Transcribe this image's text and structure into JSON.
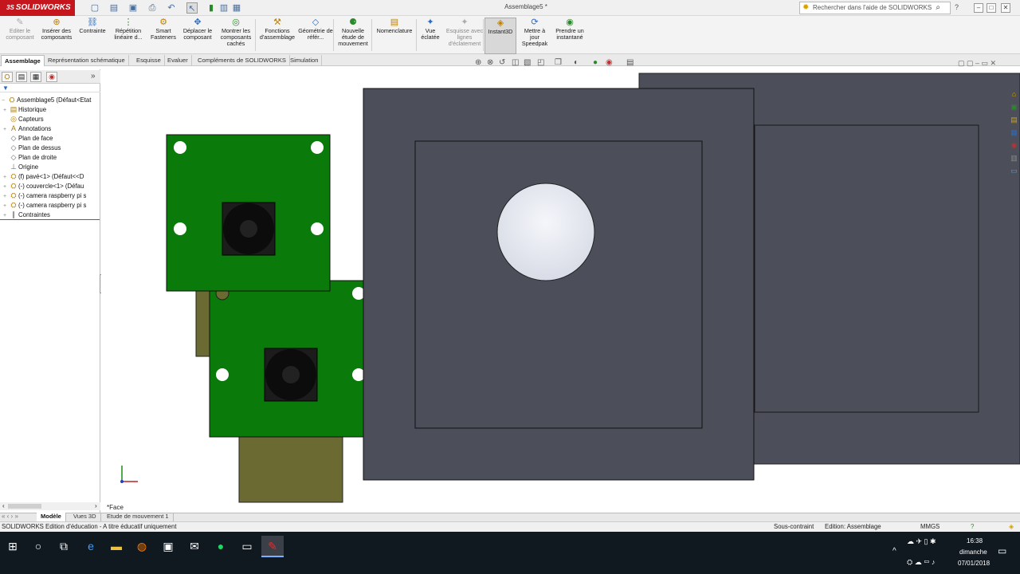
{
  "app": {
    "logo_text": "SOLIDWORKS",
    "logo_prefix": "3S",
    "document_title": "Assemblage5 *"
  },
  "search": {
    "placeholder": "Rechercher dans l'aide de SOLIDWORKS"
  },
  "ribbon": [
    {
      "label": "Editer le composant",
      "icon": "edit-component-icon",
      "disabled": true
    },
    {
      "label": "Insérer des composants",
      "icon": "insert-components-icon"
    },
    {
      "label": "Contrainte",
      "icon": "mate-icon"
    },
    {
      "label": "Répétition linéaire d...",
      "icon": "linear-pattern-icon"
    },
    {
      "label": "Smart Fasteners",
      "icon": "smart-fasteners-icon"
    },
    {
      "label": "Déplacer le composant",
      "icon": "move-component-icon"
    },
    {
      "label": "Montrer les composants cachés",
      "icon": "show-hidden-icon"
    },
    {
      "label": "Fonctions d'assemblage",
      "icon": "assembly-features-icon"
    },
    {
      "label": "Géométrie de référ...",
      "icon": "reference-geometry-icon"
    },
    {
      "label": "Nouvelle étude de mouvement",
      "icon": "motion-study-icon"
    },
    {
      "label": "Nomenclature",
      "icon": "bom-icon"
    },
    {
      "label": "Vue éclatée",
      "icon": "exploded-view-icon"
    },
    {
      "label": "Esquisse avec lignes d'éclatement",
      "icon": "explode-line-icon",
      "disabled": true
    },
    {
      "label": "Instant3D",
      "icon": "instant3d-icon",
      "active": true
    },
    {
      "label": "Mettre à jour Speedpak",
      "icon": "speedpak-icon"
    },
    {
      "label": "Prendre un instantané",
      "icon": "snapshot-icon"
    }
  ],
  "tabs": [
    "Assemblage",
    "Représentation schématique",
    "Esquisse",
    "Evaluer",
    "Compléments de SOLIDWORKS",
    "Simulation"
  ],
  "tree": [
    {
      "label": "Assemblage5  (Défaut<Etat",
      "icon": "assembly-icon",
      "expander": "−"
    },
    {
      "label": "Historique",
      "icon": "history-icon",
      "expander": "+"
    },
    {
      "label": "Capteurs",
      "icon": "sensors-icon",
      "expander": ""
    },
    {
      "label": "Annotations",
      "icon": "annotations-icon",
      "expander": "+"
    },
    {
      "label": "Plan de face",
      "icon": "plane-icon",
      "expander": ""
    },
    {
      "label": "Plan de dessus",
      "icon": "plane-icon",
      "expander": ""
    },
    {
      "label": "Plan de droite",
      "icon": "plane-icon",
      "expander": ""
    },
    {
      "label": "Origine",
      "icon": "origin-icon",
      "expander": ""
    },
    {
      "label": "(f) pavé<1> (Défaut<<D",
      "icon": "part-icon",
      "expander": "+"
    },
    {
      "label": "(-) couvercle<1> (Défau",
      "icon": "part-icon",
      "expander": "+"
    },
    {
      "label": "(-) camera raspberry pi s",
      "icon": "part-icon",
      "expander": "+"
    },
    {
      "label": "(-) camera raspberry pi s",
      "icon": "part-icon",
      "expander": "+"
    },
    {
      "label": "Contraintes",
      "icon": "mates-icon",
      "expander": "+"
    }
  ],
  "viewport": {
    "view_name": "*Face"
  },
  "bottom_tabs": [
    "Modèle",
    "Vues 3D",
    "Etude de mouvement 1"
  ],
  "status": {
    "left": "SOLIDWORKS Edition d'éducation - A titre éducatif uniquement",
    "mate_state": "Sous-contraint",
    "edit_state": "Edition: Assemblage",
    "units": "MMGS"
  },
  "clock": {
    "time": "16:38",
    "day": "dimanche",
    "date": "07/01/2018"
  },
  "colors": {
    "pcb_green": "#0a7a0a",
    "box_gray": "#4c4f5a",
    "olive": "#6b6a32",
    "brand_red": "#c4161c"
  }
}
